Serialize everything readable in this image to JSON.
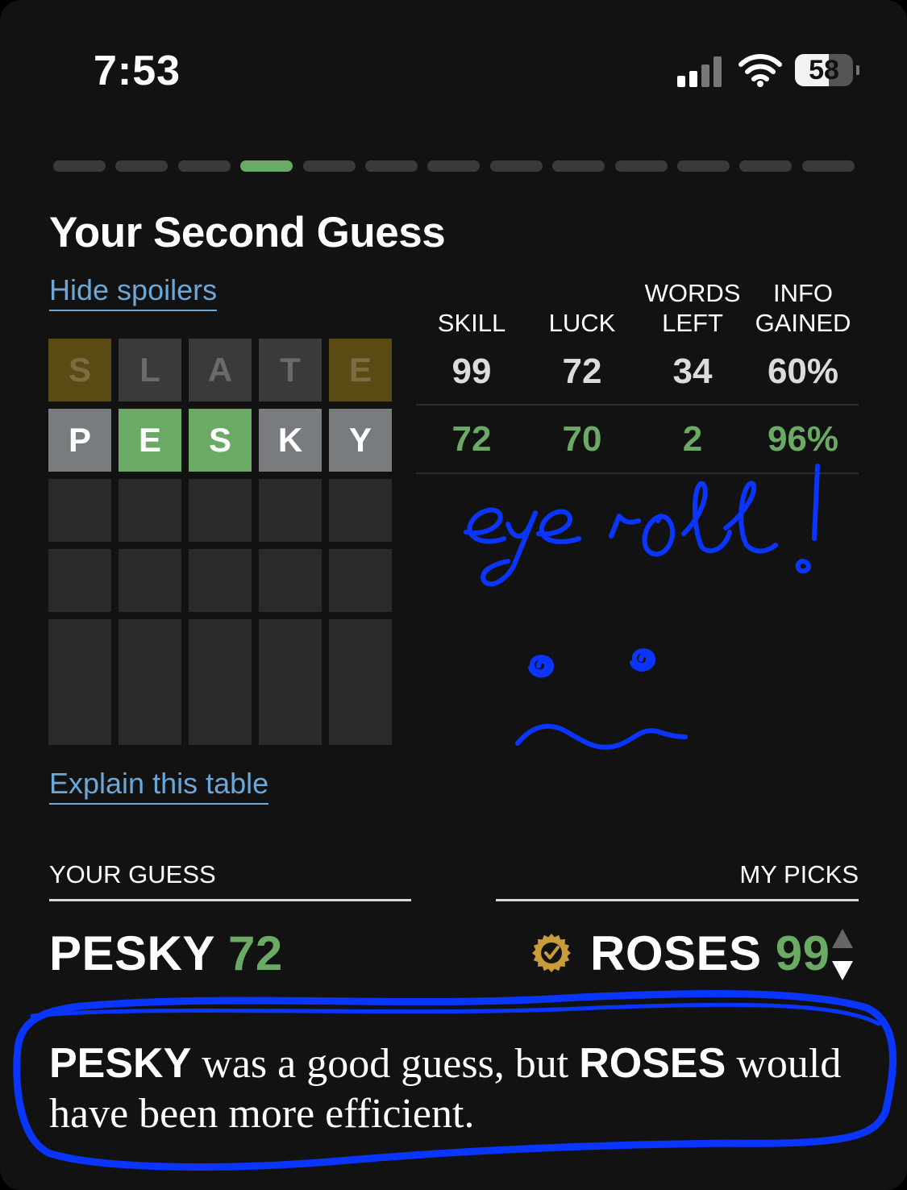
{
  "status_bar": {
    "time": "7:53",
    "battery": "58",
    "battery_level": 0.58
  },
  "progress": {
    "total": 13,
    "active_index": 3
  },
  "page": {
    "title": "Your Second Guess",
    "hide_spoilers": "Hide spoilers",
    "explain": "Explain this table"
  },
  "board": {
    "rows": [
      {
        "letters": [
          "S",
          "L",
          "A",
          "T",
          "E"
        ],
        "states": [
          "present",
          "absent",
          "absent",
          "absent",
          "present"
        ]
      },
      {
        "letters": [
          "P",
          "E",
          "S",
          "K",
          "Y"
        ],
        "states": [
          "absent",
          "correct",
          "correct",
          "absent",
          "absent"
        ]
      },
      {
        "letters": [
          "",
          "",
          "",
          "",
          ""
        ],
        "states": [
          "empty",
          "empty",
          "empty",
          "empty",
          "empty"
        ]
      },
      {
        "letters": [
          "",
          "",
          "",
          "",
          ""
        ],
        "states": [
          "empty",
          "empty",
          "empty",
          "empty",
          "empty"
        ]
      },
      {
        "letters": [
          "",
          "",
          "",
          "",
          ""
        ],
        "states": [
          "empty",
          "empty",
          "empty",
          "empty",
          "empty"
        ]
      }
    ]
  },
  "stats": {
    "headers": {
      "skill": [
        "SKILL"
      ],
      "luck": [
        "LUCK"
      ],
      "words_left": [
        "WORDS",
        "LEFT"
      ],
      "info_gained": [
        "INFO",
        "GAINED"
      ]
    },
    "rows": [
      {
        "skill": "99",
        "luck": "72",
        "words_left": "34",
        "info_gained": "60%"
      },
      {
        "skill": "72",
        "luck": "70",
        "words_left": "2",
        "info_gained": "96%"
      }
    ]
  },
  "comparison": {
    "your_guess_label": "YOUR GUESS",
    "my_picks_label": "MY PICKS",
    "your_word": "PESKY",
    "your_score": "72",
    "pick_word": "ROSES",
    "pick_score": "99"
  },
  "summary": {
    "word1": "PESKY",
    "text1": " was a good guess, but ",
    "word2": "ROSES",
    "text2": " would have been more efficient."
  },
  "annotation": {
    "text": "eye roll!",
    "color": "#0a35ff"
  },
  "colors": {
    "background": "#121213",
    "correct": "#6aaa64",
    "present": "#5a4b14",
    "absent": "#787c7e",
    "link": "#6ba7d8"
  }
}
